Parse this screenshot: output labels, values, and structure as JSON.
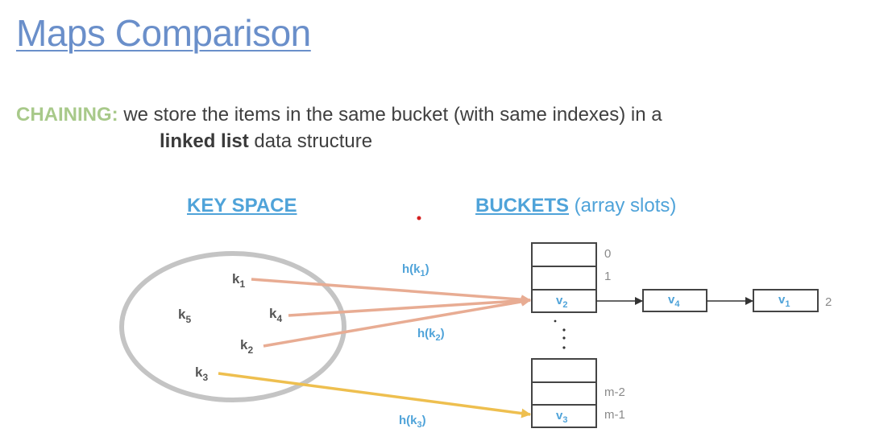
{
  "title": "Maps Comparison",
  "description": {
    "keyword": "CHAINING:",
    "line1": " we store the items in the same bucket (with same indexes) in a",
    "bold": "linked list",
    "line2_rest": " data structure"
  },
  "key_space_heading": "KEY SPACE",
  "buckets_heading": "BUCKETS",
  "buckets_heading_suffix": " (array slots)",
  "keys": [
    {
      "base": "k",
      "sub": "1"
    },
    {
      "base": "k",
      "sub": "4"
    },
    {
      "base": "k",
      "sub": "5"
    },
    {
      "base": "k",
      "sub": "2"
    },
    {
      "base": "k",
      "sub": "3"
    }
  ],
  "hash_labels": [
    {
      "base": "h(k",
      "sub": "1",
      "close": ")"
    },
    {
      "base": "h(k",
      "sub": "2",
      "close": ")"
    },
    {
      "base": "h(k",
      "sub": "3",
      "close": ")"
    }
  ],
  "bucket_indices": [
    "0",
    "1",
    "m-2",
    "m-1"
  ],
  "chain_index": "2",
  "values": [
    {
      "base": "v",
      "sub": "2"
    },
    {
      "base": "v",
      "sub": "4"
    },
    {
      "base": "v",
      "sub": "1"
    },
    {
      "base": "v",
      "sub": "3"
    }
  ],
  "colors": {
    "title": "#6a8fca",
    "chaining": "#a8c98a",
    "heading": "#4fa3d9",
    "arrow_salmon": "#e8ac93",
    "arrow_yellow": "#eebf4f",
    "ellipse": "#c4c4c4"
  }
}
